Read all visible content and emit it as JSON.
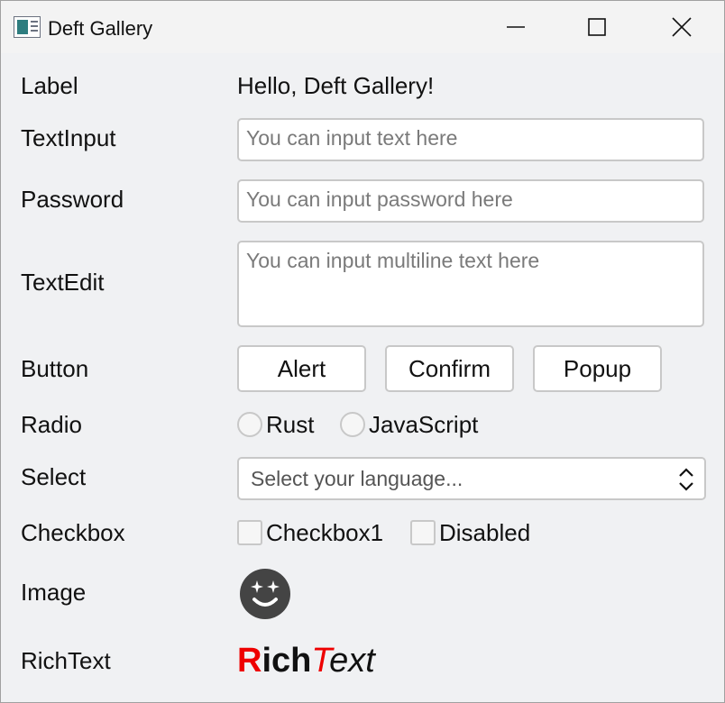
{
  "window": {
    "title": "Deft Gallery"
  },
  "rows": {
    "label": {
      "label": "Label",
      "value": "Hello, Deft Gallery!"
    },
    "text_input": {
      "label": "TextInput",
      "placeholder": "You can input text here"
    },
    "password": {
      "label": "Password",
      "placeholder": "You can input password here"
    },
    "text_edit": {
      "label": "TextEdit",
      "placeholder": "You can input multiline text here"
    },
    "button": {
      "label": "Button",
      "buttons": [
        "Alert",
        "Confirm",
        "Popup"
      ]
    },
    "radio": {
      "label": "Radio",
      "options": [
        "Rust",
        "JavaScript"
      ]
    },
    "select": {
      "label": "Select",
      "placeholder": "Select your language..."
    },
    "checkbox": {
      "label": "Checkbox",
      "options": [
        "Checkbox1",
        "Disabled"
      ]
    },
    "image": {
      "label": "Image",
      "icon": "smiley-icon"
    },
    "rich_text": {
      "label": "RichText",
      "parts": [
        "R",
        "ich",
        "T",
        "ext"
      ]
    }
  },
  "colors": {
    "rich_red": "#ee0000",
    "smiley_bg": "#444444"
  }
}
